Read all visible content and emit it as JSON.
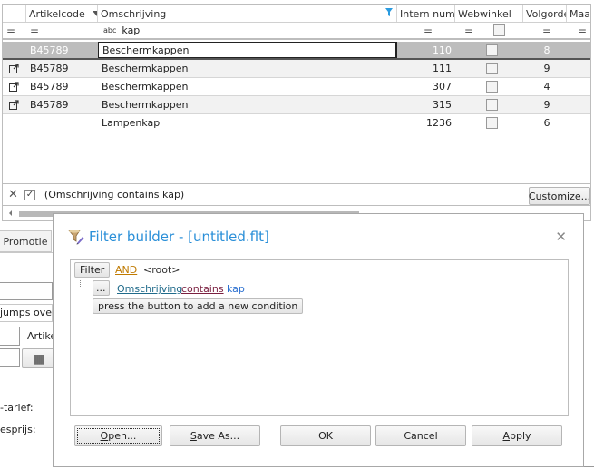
{
  "grid": {
    "columns": [
      {
        "key": "indicator",
        "label": ""
      },
      {
        "key": "artikelcode",
        "label": "Artikelcode",
        "sorted": "descending"
      },
      {
        "key": "omschrijving",
        "label": "Omschrijving",
        "filtered": true
      },
      {
        "key": "intern_nummer",
        "label": "Intern numm"
      },
      {
        "key": "webwinkel",
        "label": "Webwinkel"
      },
      {
        "key": "volgorde",
        "label": "Volgorde"
      },
      {
        "key": "maat",
        "label": "Maat/"
      }
    ],
    "auto_filter": {
      "operator_symbol": "=",
      "omschrijving_type": "abc",
      "omschrijving_value": "kap",
      "webwinkel_checked": false
    },
    "rows": [
      {
        "icon": "",
        "artikelcode": "B45789",
        "omschrijving": "Beschermkappen",
        "intern_nummer": "110",
        "webwinkel": false,
        "volgorde": "8",
        "selected": true
      },
      {
        "icon": "external-link-icon",
        "artikelcode": "B45789",
        "omschrijving": "Beschermkappen",
        "intern_nummer": "111",
        "webwinkel": false,
        "volgorde": "9",
        "selected": false
      },
      {
        "icon": "external-link-icon",
        "artikelcode": "B45789",
        "omschrijving": "Beschermkappen",
        "intern_nummer": "307",
        "webwinkel": false,
        "volgorde": "4",
        "selected": false
      },
      {
        "icon": "external-link-icon",
        "artikelcode": "B45789",
        "omschrijving": "Beschermkappen",
        "intern_nummer": "315",
        "webwinkel": false,
        "volgorde": "9",
        "selected": false
      },
      {
        "icon": "",
        "artikelcode": "",
        "omschrijving": "Lampenkap",
        "intern_nummer": "1236",
        "webwinkel": false,
        "volgorde": "6",
        "selected": false
      }
    ],
    "filter_panel": {
      "close_glyph": "✕",
      "enabled": true,
      "expression": "(Omschrijving contains kap)",
      "customize_label": "Customize..."
    }
  },
  "background_form": {
    "tab_label": "Promotie",
    "text_jumps": "jumps over t",
    "label_artikel": "Artike",
    "label_tarief": "-tarief:",
    "label_prijs": "esprijs:",
    "barcode_glyph": "|||||"
  },
  "dialog": {
    "title": "Filter builder - [untitled.flt]",
    "close_glyph": "✕",
    "tree": {
      "root_button": "Filter",
      "group_operator": "AND",
      "root_label": "<root>",
      "condition_button": "...",
      "condition": {
        "field": "Omschrijving",
        "operator": "contains",
        "value": "kap"
      },
      "add_condition_label": "press the button to add a new condition"
    },
    "buttons": {
      "open": {
        "accel": "O",
        "rest": "pen..."
      },
      "save_as": {
        "accel": "S",
        "rest": "ave As..."
      },
      "ok": "OK",
      "cancel": "Cancel",
      "apply": {
        "accel": "A",
        "rest": "pply"
      }
    }
  },
  "colors": {
    "accent_title": "#2a8fd8",
    "selected_row": "#bdbdbd",
    "and_operator": "#c07a00"
  }
}
